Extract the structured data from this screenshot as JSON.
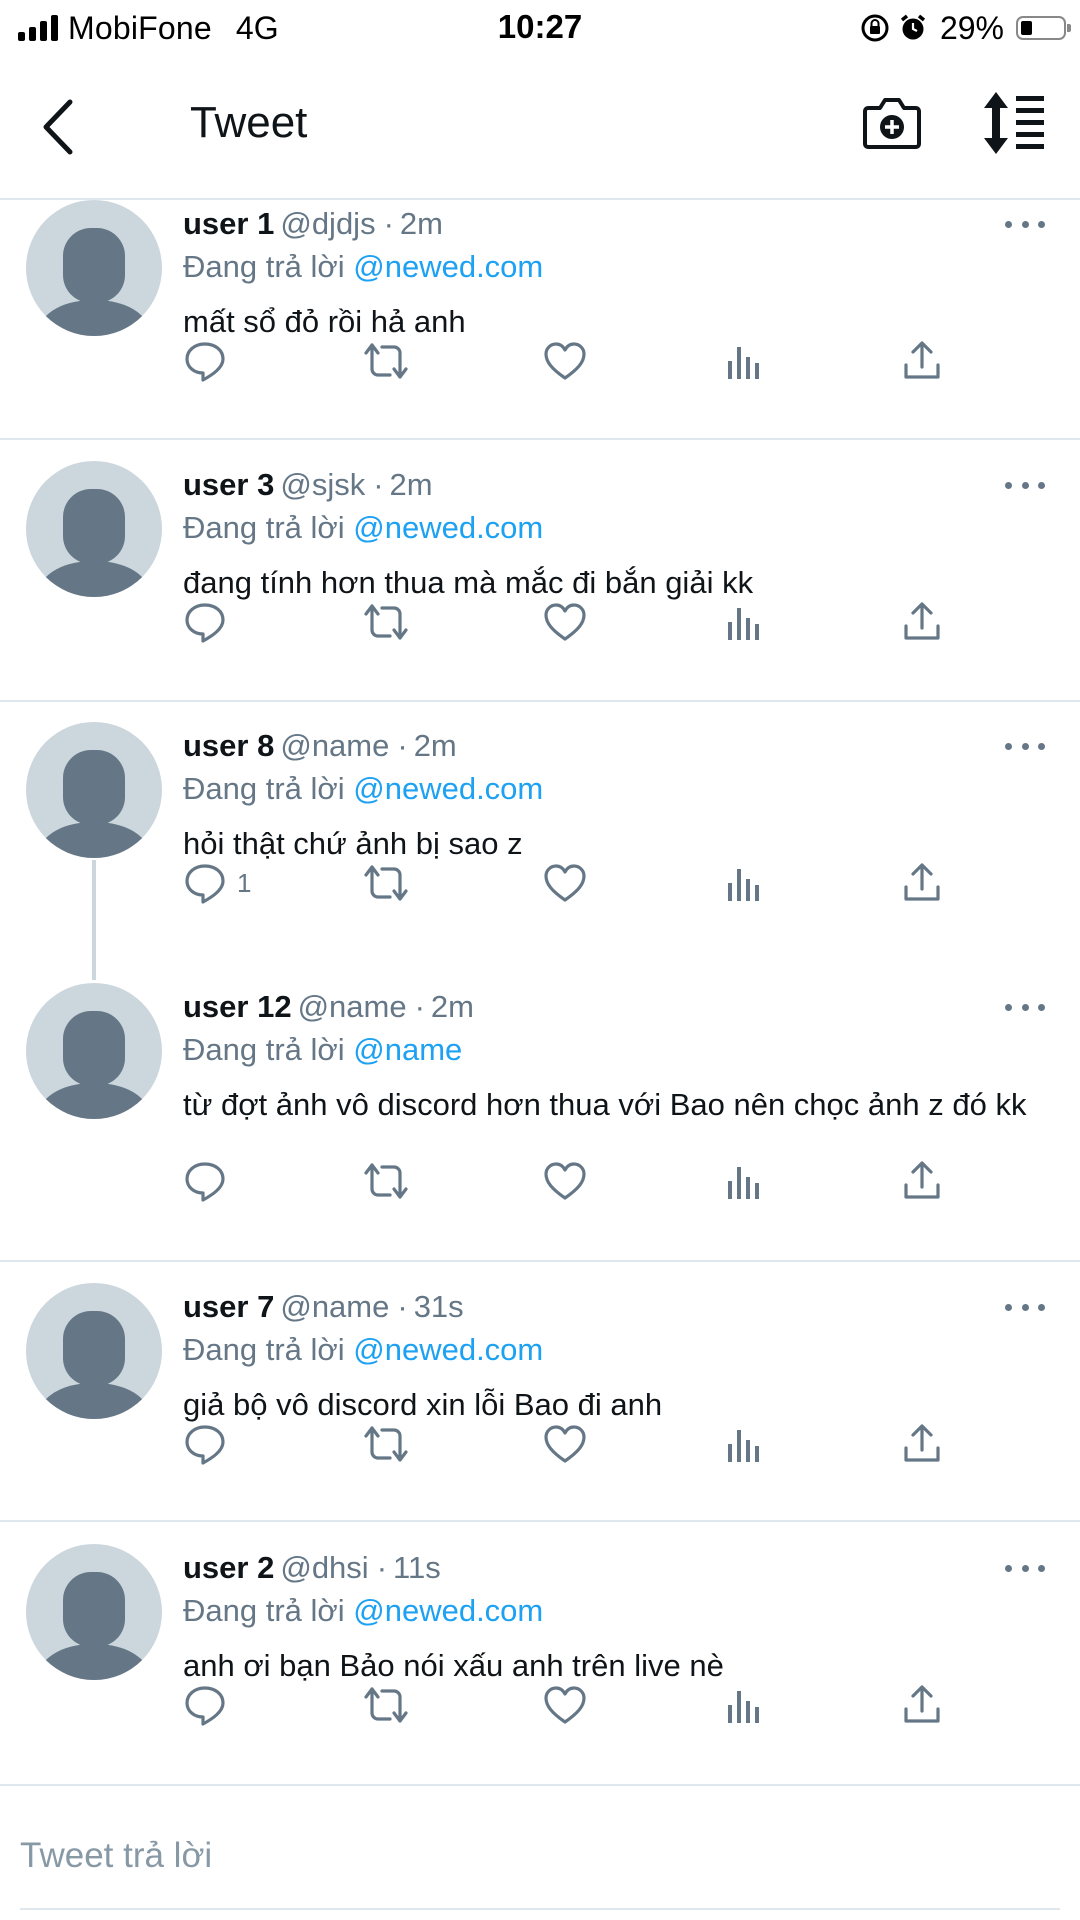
{
  "status_bar": {
    "carrier": "MobiFone",
    "network": "4G",
    "time": "10:27",
    "battery_percent": "29%",
    "battery_level": 0.29
  },
  "nav": {
    "title": "Tweet",
    "icons": [
      "back-chevron-icon",
      "camera-plus-icon",
      "sort-icon"
    ]
  },
  "reply_prefix": "Đang trả lời",
  "tweets": [
    {
      "name": "user 1",
      "handle": "@djdjs",
      "time": "2m",
      "reply_to": "@newed.com",
      "text": "mất sổ đỏ rồi hả anh",
      "reply_count": ""
    },
    {
      "name": "user 3",
      "handle": "@sjsk",
      "time": "2m",
      "reply_to": "@newed.com",
      "text": "đang tính hơn thua mà mắc đi bắn giải kk",
      "reply_count": ""
    },
    {
      "name": "user 8",
      "handle": "@name",
      "time": "2m",
      "reply_to": "@newed.com",
      "text": "hỏi thật chứ ảnh bị sao z",
      "reply_count": "1"
    },
    {
      "name": "user 12",
      "handle": "@name",
      "time": "2m",
      "reply_to": "@name",
      "text": "từ đợt ảnh vô discord hơn thua với Bao nên chọc ảnh z đó kk",
      "reply_count": ""
    },
    {
      "name": "user 7",
      "handle": "@name",
      "time": "31s",
      "reply_to": "@newed.com",
      "text": "giả bộ vô discord xin lỗi Bao đi anh",
      "reply_count": ""
    },
    {
      "name": "user 2",
      "handle": "@dhsi",
      "time": "11s",
      "reply_to": "@newed.com",
      "text": "anh ơi bạn Bảo nói xấu anh trên live nè",
      "reply_count": ""
    }
  ],
  "composer": {
    "placeholder": "Tweet trả lời"
  },
  "colors": {
    "link": "#1da1f2",
    "secondary_text": "#657786",
    "avatar_bg": "#ccd6dd",
    "avatar_fg": "#657786",
    "divider": "#e1e8ed"
  }
}
